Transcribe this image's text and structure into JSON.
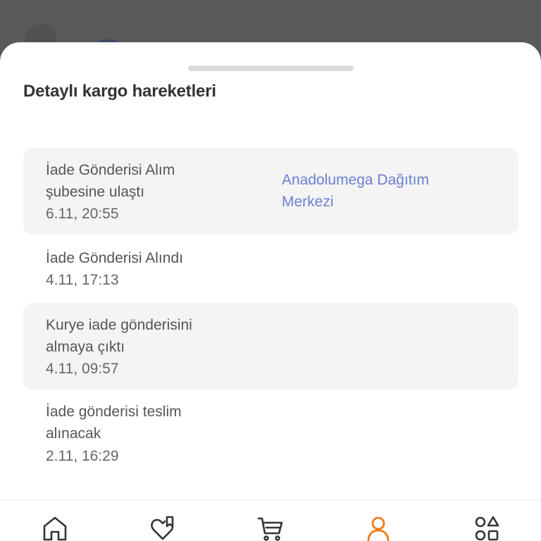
{
  "sheet": {
    "section_title": "Detaylı kargo hareketleri"
  },
  "events": [
    {
      "title": "İade Gönderisi Alım şubesine ulaştı",
      "time": "6.11, 20:55",
      "location": "Anadolumega Dağıtım Merkezi"
    },
    {
      "title": "İade Gönderisi Alındı",
      "time": "4.11, 17:13",
      "location": ""
    },
    {
      "title": "Kurye iade gönderisini almaya çıktı",
      "time": "4.11, 09:57",
      "location": ""
    },
    {
      "title": "İade gönderisi teslim alınacak",
      "time": "2.11, 16:29",
      "location": ""
    }
  ],
  "nav": {
    "items": [
      {
        "icon": "home-icon",
        "active": false
      },
      {
        "icon": "favorites-icon",
        "active": false
      },
      {
        "icon": "cart-icon",
        "active": false
      },
      {
        "icon": "account-icon",
        "active": true
      },
      {
        "icon": "categories-icon",
        "active": false
      }
    ]
  },
  "colors": {
    "accent": "#f27a1a",
    "link": "#6b7fd1",
    "row_background": "#f4f4f4",
    "icon_default": "#333333"
  }
}
